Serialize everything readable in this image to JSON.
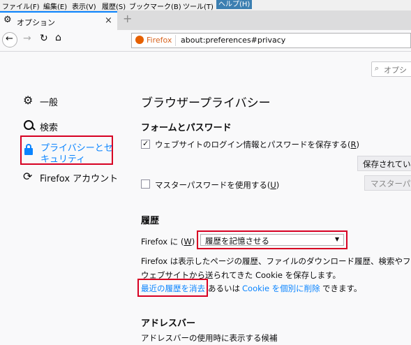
{
  "menubar": {
    "items": [
      "ファイル(F)",
      "編集(E)",
      "表示(V)",
      "履歴(S)",
      "ブックマーク(B)",
      "ツール(T)",
      "ヘルプ(H)"
    ]
  },
  "tab": {
    "title": "オプション",
    "close": "×",
    "new_tab": "+"
  },
  "urlbar": {
    "identity": "Firefox",
    "url": "about:preferences#privacy"
  },
  "search": {
    "placeholder": "オプシ"
  },
  "sidebar": {
    "general": "一般",
    "search": "検索",
    "privacy_line1": "プライバシーとセ",
    "privacy_line2": "キュリティ",
    "account": "Firefox アカウント"
  },
  "main": {
    "title": "ブラウザープライバシー",
    "forms_heading": "フォームとパスワード",
    "save_logins_label": "ウェブサイトのログイン情報とパスワードを保存する(",
    "save_logins_key": "R",
    "save_logins_end": ")",
    "saved_button": "保存されてい",
    "master_password_label": "マスターパスワードを使用する(",
    "master_password_key": "U",
    "master_password_end": ")",
    "master_button": "マスターパ",
    "history_heading": "履歴",
    "history_label_pre": "Firefox に (",
    "history_label_key": "W",
    "history_label_end": ")",
    "history_select": "履歴を記憶させる",
    "history_desc1": "Firefox は表示したページの履歴、ファイルのダウンロード履歴、検索やフォ",
    "history_desc2": "ウェブサイトから送られてきた Cookie を保存します。",
    "clear_history_link": "最近の履歴を消去",
    "or_text": "あるいは",
    "remove_cookie_link": "Cookie を個別に削除",
    "can_text": "できます。",
    "address_heading": "アドレスバー",
    "address_desc": "アドレスバーの使用時に表示する候補"
  },
  "colors": {
    "accent": "#0a84ff",
    "highlight": "#d70022",
    "checked": true
  }
}
